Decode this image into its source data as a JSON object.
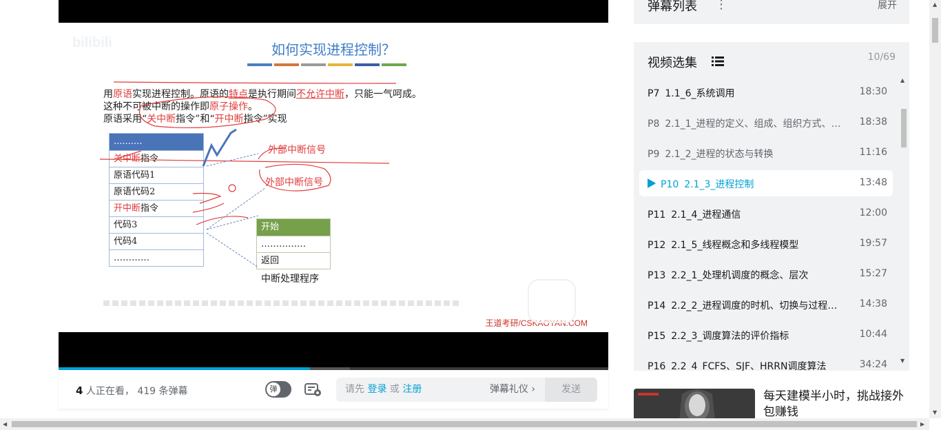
{
  "slide": {
    "title": "如何实现进程控制？",
    "line1": [
      "用",
      "原语",
      "实现进程控制。原语的",
      "特点",
      "是执行期间",
      "不允许中断",
      "，只能一气呵成。"
    ],
    "line2": [
      "这种不可被中断的操作即",
      "原子操作",
      "。"
    ],
    "line3": [
      "原语采用“",
      "关中断",
      "指令”和“",
      "开中断",
      "指令”实现"
    ],
    "code_rows": [
      "..........",
      "关中断",
      "指令",
      "原语代码1",
      "原语代码2",
      "开中断",
      "指令",
      "代码3",
      "代码4",
      "…………"
    ],
    "handler_rows": [
      "开始",
      "……………",
      "返回"
    ],
    "handler_caption": "中断处理程序",
    "annotation_1": "外部中断信号",
    "annotation_2": "外部中断信号",
    "brand": "王道考研/CSKAOYAN.COM",
    "watermark": "bilibili"
  },
  "progress": {
    "played_fraction": 0.457,
    "buffered_fraction": 0.53
  },
  "bottom_bar": {
    "viewer_count": "4",
    "viewer_text": " 人正在看， 419 条弹幕",
    "toggle_label": "弹",
    "input_prefix": "请先 ",
    "login": "登录",
    "or": " 或 ",
    "register": "注册",
    "etiquette": "弹幕礼仪 ›",
    "send": "发送"
  },
  "danmaku_list": {
    "title": "弹幕列表",
    "expand": "展开"
  },
  "episodes": {
    "title": "视频选集",
    "count": "10/69",
    "items": [
      {
        "num": "P7",
        "title": "1.1_6_系统调用",
        "duration": "18:30"
      },
      {
        "num": "P8",
        "title": "2.1_1_进程的定义、组成、组织方式、…",
        "duration": "18:38"
      },
      {
        "num": "P9",
        "title": "2.1_2_进程的状态与转换",
        "duration": "11:16"
      },
      {
        "num": "P10",
        "title": "2.1_3_进程控制",
        "duration": "13:48"
      },
      {
        "num": "P11",
        "title": "2.1_4_进程通信",
        "duration": "12:00"
      },
      {
        "num": "P12",
        "title": "2.1_5_线程概念和多线程模型",
        "duration": "19:57"
      },
      {
        "num": "P13",
        "title": "2.2_1_处理机调度的概念、层次",
        "duration": "15:27"
      },
      {
        "num": "P14",
        "title": "2.2_2_进程调度的时机、切换与过程…",
        "duration": "14:38"
      },
      {
        "num": "P15",
        "title": "2.2_3_调度算法的评价指标",
        "duration": "10:44"
      },
      {
        "num": "P16",
        "title": "2.2_4_FCFS、SJF、HRRN调度算法",
        "duration": "34:24"
      }
    ]
  },
  "recommend": {
    "title": "每天建模半小时，挑战接外包赚钱"
  },
  "colors": {
    "accent": "#00a1d6",
    "slide_title": "#3d7cc9",
    "ink_red": "#e23b3b"
  }
}
